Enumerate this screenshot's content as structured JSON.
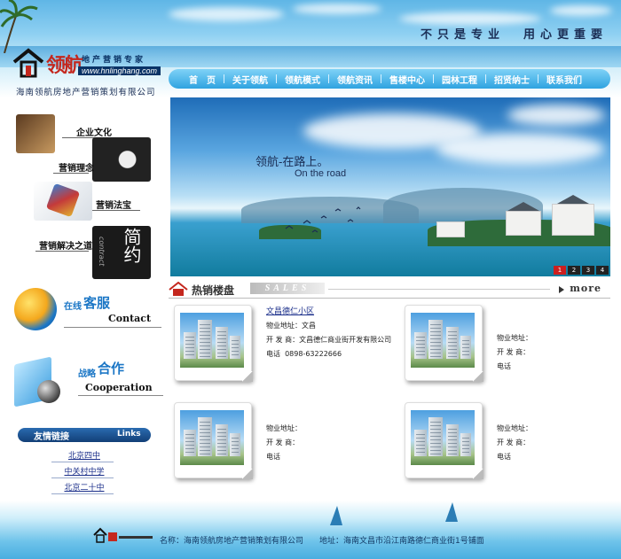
{
  "header": {
    "slogan_left": "不只是专业",
    "slogan_right": "用心更重要",
    "logo_cn": "领航",
    "logo_tagline": "地产营销专家",
    "logo_url": "www.hnlinghang.com",
    "company": "海南领航房地产营销策划有限公司"
  },
  "nav": {
    "items": [
      "首　页",
      "关于领航",
      "领航模式",
      "领航资讯",
      "售楼中心",
      "园林工程",
      "招贤纳士",
      "联系我们"
    ]
  },
  "banner": {
    "title": "领航-在路上。",
    "subtitle": "On the road",
    "pages": [
      "1",
      "2",
      "3",
      "4"
    ],
    "active_page": "1"
  },
  "sidebar": {
    "culture": [
      "企业文化",
      "营销理念",
      "营销法宝",
      "营销解决之道"
    ],
    "contract_cn": "简约",
    "contract_en": "contract",
    "contact": {
      "cn_small": "在线",
      "cn_big": "客服",
      "en": "Contact"
    },
    "cooperation": {
      "cn_small": "战略",
      "cn_big": "合作",
      "en": "Cooperation"
    },
    "links": {
      "title_cn": "友情链接",
      "title_en": "Links",
      "items": [
        "北京四中",
        "中关村中学",
        "北京二十中"
      ]
    }
  },
  "sales": {
    "title_cn": "热销楼盘",
    "title_en": "SALES",
    "more": "more",
    "listings": [
      {
        "name": "文昌德仁小区",
        "address_label": "物业地址：",
        "address": "文昌",
        "developer_label": "开 发 商：",
        "developer": "文昌德仁商业街开发有限公司",
        "phone_label": "电话",
        "phone": "0898-63222666"
      },
      {
        "name": "",
        "address_label": "物业地址：",
        "address": "",
        "developer_label": "开 发 商：",
        "developer": "",
        "phone_label": "电话",
        "phone": ""
      },
      {
        "name": "",
        "address_label": "物业地址：",
        "address": "",
        "developer_label": "开 发 商：",
        "developer": "",
        "phone_label": "电话",
        "phone": ""
      },
      {
        "name": "",
        "address_label": "物业地址：",
        "address": "",
        "developer_label": "开 发 商：",
        "developer": "",
        "phone_label": "电话",
        "phone": ""
      }
    ]
  },
  "footer": {
    "name_label": "名称：",
    "name": "海南领航房地产营销策划有限公司",
    "address_label": "地址：",
    "address": "海南文昌市沿江南路德仁商业街1号铺面"
  },
  "colors": {
    "nav_bg": "#2fa3e0",
    "brand_red": "#c4271e",
    "brand_blue": "#1c77c6",
    "link": "#1a2e8a"
  }
}
